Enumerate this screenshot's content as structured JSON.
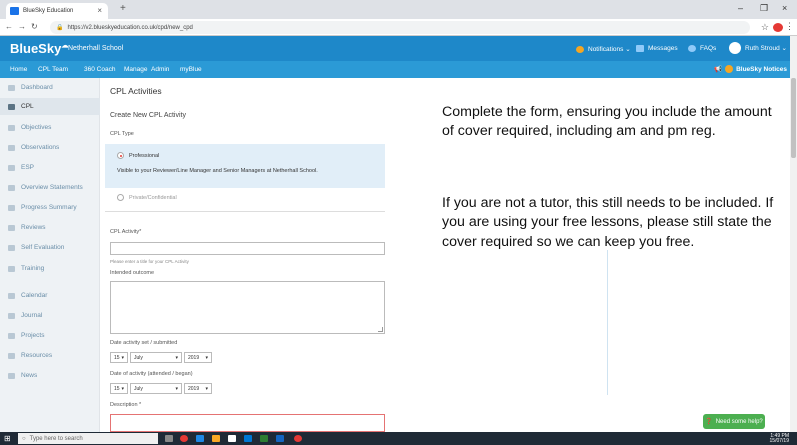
{
  "browser": {
    "tab_title": "BlueSky Education",
    "tab_close": "×",
    "new_tab": "+",
    "url": "https://v2.blueskyeducation.co.uk/cpd/new_cpd",
    "minimize": "–",
    "restore": "❐",
    "close": "×"
  },
  "header": {
    "brand": "BlueSky",
    "school": "Netherhall School",
    "notifications": "Notifications ⌄",
    "messages": "Messages",
    "faqs": "FAQs",
    "user": "Ruth Stroud ⌄"
  },
  "nav": {
    "items": [
      "Home",
      "CPL Team",
      "360 Coach",
      "Manage",
      "Admin",
      "myBlue"
    ],
    "notices": "BlueSky Notices"
  },
  "sidebar": {
    "items": [
      "Dashboard",
      "CPL",
      "Objectives",
      "Observations",
      "ESP",
      "Overview Statements",
      "Progress Summary",
      "Reviews",
      "Self Evaluation",
      "Training",
      "Calendar",
      "Journal",
      "Projects",
      "Resources",
      "News"
    ]
  },
  "main": {
    "page_title": "CPL Activities",
    "section_title": "Create New CPL Activity",
    "type_label": "CPL Type",
    "option_professional": "Professional",
    "option_professional_desc": "Visible to your Reviewer/Line Manager and Senior Managers at Netherhall School.",
    "option_private": "Private/Confidential",
    "activity_label": "CPL Activity*",
    "activity_help": "Please enter a title for your CPL Activity",
    "outcome_label": "Intended outcome",
    "date_set_label": "Date activity set / submitted",
    "date_set": {
      "day": "15",
      "month": "July",
      "year": "2019"
    },
    "date_attended_label": "Date of activity (attended / began)",
    "date_attended": {
      "day": "15",
      "month": "July",
      "year": "2019"
    },
    "description_label": "Description *"
  },
  "note": {
    "para1": "Complete the form, ensuring you include the amount of cover required, including am and pm reg.",
    "para2": "If you are not a tutor, this still needs to be included. If you are using your free lessons, please still state the cover required so we can keep you free."
  },
  "help_button": "Need some help?",
  "taskbar": {
    "search_placeholder": "Type here to search",
    "time": "1:49 PM",
    "date": "15/07/19"
  },
  "colors": {
    "header_blue": "#1e88c9",
    "nav_blue": "#2b9ad6",
    "option_bg": "#e1eef8",
    "help_green": "#4caf50"
  }
}
